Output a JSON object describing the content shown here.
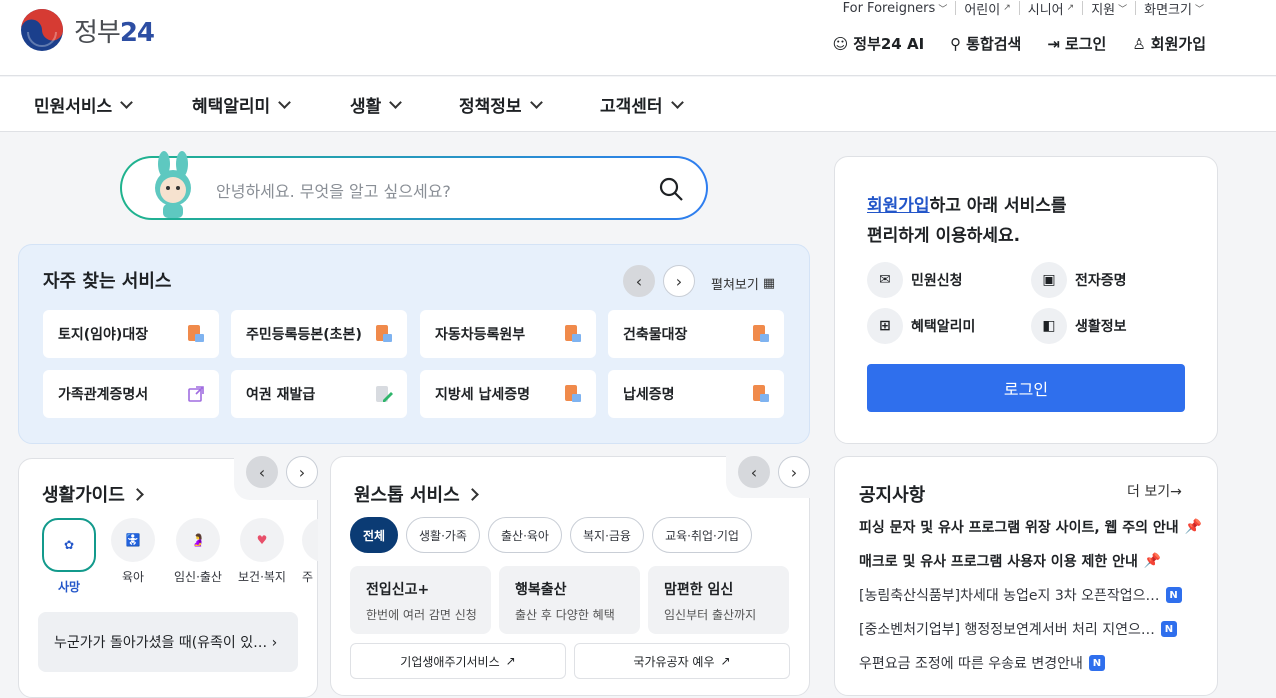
{
  "brand": {
    "logo_text_a": "정부",
    "logo_text_b": "24"
  },
  "util": [
    "For Foreigners",
    "어린이",
    "시니어",
    "지원",
    "화면크기"
  ],
  "topnav": [
    "정부24 AI",
    "통합검색",
    "로그인",
    "회원가입"
  ],
  "gnb": [
    "민원서비스",
    "혜택알리미",
    "생활",
    "정책정보",
    "고객센터"
  ],
  "search": {
    "placeholder": "안녕하세요. 무엇을 알고 싶으세요?"
  },
  "favorites": {
    "title": "자주 찾는 서비스",
    "expand": "펼쳐보기",
    "items": [
      "토지(임야)대장",
      "주민등록등본(초본)",
      "자동차등록원부",
      "건축물대장",
      "가족관계증명서",
      "여권 재발급",
      "지방세 납세증명",
      "납세증명"
    ]
  },
  "login_card": {
    "link": "회원가입",
    "line1_rest": "하고 아래 서비스를",
    "line2": "편리하게 이용하세요.",
    "features": [
      "민원신청",
      "전자증명",
      "혜택알리미",
      "생활정보"
    ],
    "button": "로그인"
  },
  "notices": {
    "title": "공지사항",
    "more": "더 보기→",
    "items": [
      "피싱 문자 및 유사 프로그램 위장 사이트, 웹 주의 안내",
      "매크로 및 유사 프로그램 사용자 이용 제한 안내",
      "[농림축산식품부]차세대 농업e지 3차 오픈작업으…",
      "[중소벤처기업부] 행정정보연계서버 처리 지연으…",
      "우편요금 조정에 따른 우송료 변경안내"
    ],
    "badge": "N"
  },
  "guide": {
    "title": "생활가이드",
    "items": [
      "사망",
      "육아",
      "임신·출산",
      "보건·복지",
      "주"
    ],
    "question": "누군가가 돌아가셨을 때(유족이 있…"
  },
  "onestop": {
    "title": "원스톱 서비스",
    "chips": [
      "전체",
      "생활·가족",
      "출산·육아",
      "복지·금융",
      "교육·취업·기업"
    ],
    "boxes": [
      {
        "t": "전입신고+",
        "s": "한번에 여러 감면 신청"
      },
      {
        "t": "행복출산",
        "s": "출산 후 다양한 혜택"
      },
      {
        "t": "맘편한 임신",
        "s": "임신부터 출산까지"
      }
    ],
    "links": [
      "기업생애주기서비스",
      "국가유공자 예우"
    ]
  }
}
